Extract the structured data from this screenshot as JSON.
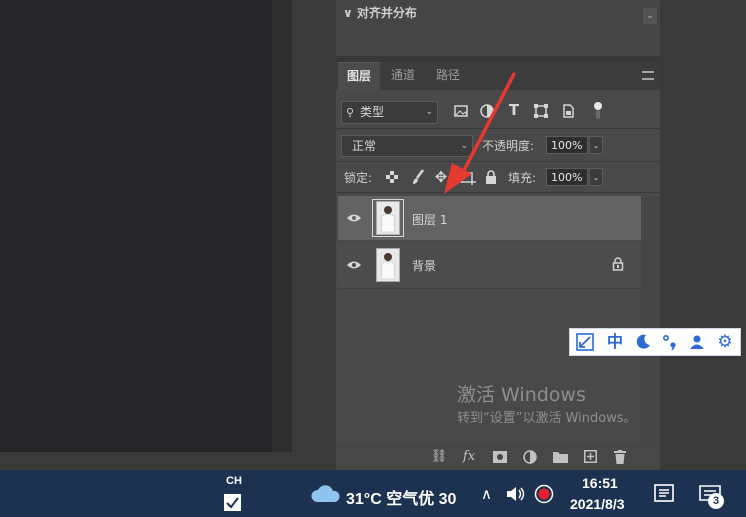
{
  "align_panel": {
    "title": "∨ 对齐并分布",
    "collapse_icon": "⌄"
  },
  "layers_panel": {
    "tabs": [
      {
        "label": "图层",
        "active": true
      },
      {
        "label": "通道",
        "active": false
      },
      {
        "label": "路径",
        "active": false
      }
    ],
    "filter": {
      "value": "类型",
      "icons": [
        "image-icon",
        "adjustment-icon",
        "type-icon",
        "shape-icon",
        "smart-object-icon",
        "toggle-icon"
      ]
    },
    "blend_mode": "正常",
    "opacity_label": "不透明度:",
    "opacity_value": "100%",
    "lock_label": "锁定:",
    "fill_label": "填充:",
    "fill_value": "100%",
    "layers": [
      {
        "name": "图层 1",
        "visible": true,
        "selected": true,
        "locked": false
      },
      {
        "name": "背景",
        "visible": true,
        "selected": false,
        "locked": true
      }
    ]
  },
  "ime_toolbar": {
    "mode_label": "中"
  },
  "activation": {
    "title": "激活 Windows",
    "subtitle": "转到“设置”以激活 Windows。"
  },
  "taskbar": {
    "language": "CH",
    "weather": "31°C 空气优 30",
    "time": "16:51",
    "date": "2021/8/3",
    "notification_count": "3"
  },
  "colors": {
    "panel_bg": "#494949",
    "selected_row": "#636363",
    "taskbar_bg": "#1d3150",
    "annotation_arrow": "#e53a32",
    "ime_blue": "#2d69d6"
  }
}
